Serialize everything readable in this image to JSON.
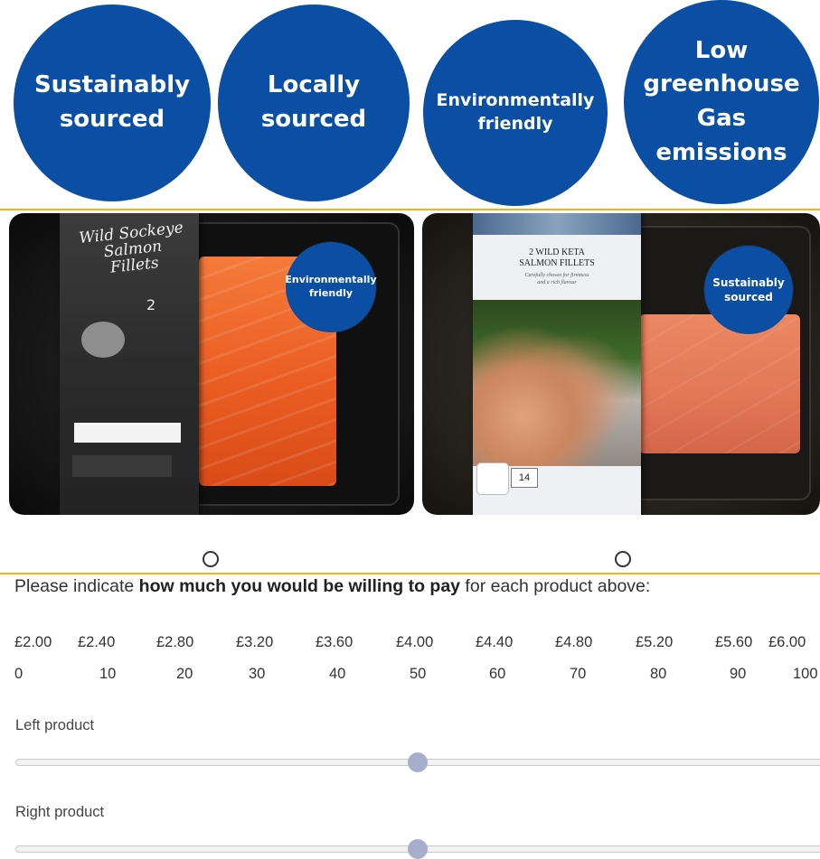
{
  "badges": [
    {
      "text": "Sustainably\nsourced"
    },
    {
      "text": "Locally\nsourced"
    },
    {
      "text": "Environmentally\nfriendly"
    },
    {
      "text": "Low\ngreenhouse\nGas\nemissions"
    }
  ],
  "left_product": {
    "pack_title": "Wild Sockeye\nSalmon\nFillets",
    "pack_quantity": "2",
    "label_badge": "Environmentally\nfriendly"
  },
  "right_product": {
    "pack_title": "2 WILD KETA\nSALMON FILLETS",
    "pack_subtitle": "Carefully chosen for firmness\nand a rich flavour",
    "pack_number": "14",
    "label_badge": "Sustainably\nsourced"
  },
  "question": {
    "prefix": "Please indicate ",
    "emphasis": "how much you would be willing to pay",
    "suffix": " for each product above:"
  },
  "price_ticks": [
    "£2.00",
    "£2.40",
    "£2.80",
    "£3.20",
    "£3.60",
    "£4.00",
    "£4.40",
    "£4.80",
    "£5.20",
    "£5.60",
    "£6.00"
  ],
  "scale_ticks": [
    "0",
    "10",
    "20",
    "30",
    "40",
    "50",
    "60",
    "70",
    "80",
    "90",
    "100"
  ],
  "sliders": [
    {
      "label": "Left product",
      "value": 50
    },
    {
      "label": "Right product",
      "value": 50
    }
  ],
  "colors": {
    "badge_blue": "#0a4fa3",
    "divider": "#f2b21a",
    "thumb": "#a7aec9"
  }
}
